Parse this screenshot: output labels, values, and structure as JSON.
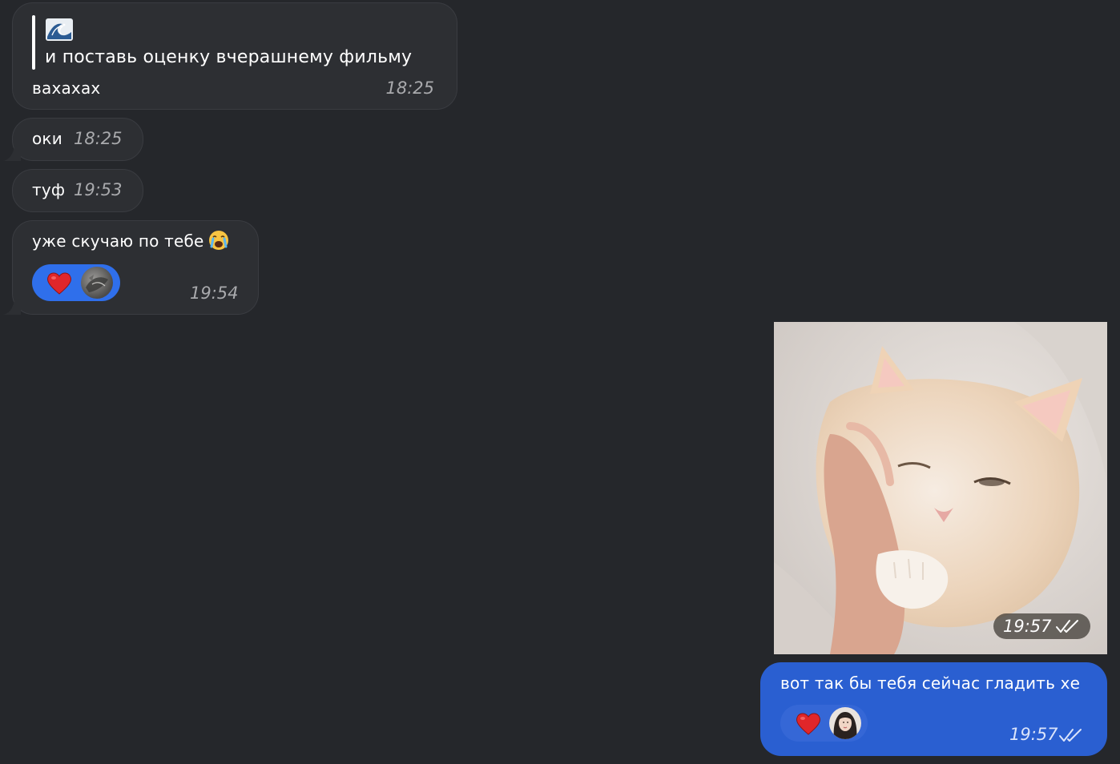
{
  "colors": {
    "background": "#25272b",
    "incoming_bubble": "#2d2f33",
    "outgoing_bubble": "#2a5fd1",
    "reaction_pill_incoming": "#2f6feb",
    "reaction_pill_outgoing": "#3567d6"
  },
  "messages": [
    {
      "quote": {
        "icon": "wave-emoji-icon",
        "text": "и поставь оценку вчерашнему фильму"
      },
      "text": "вахахах",
      "time": "18:25"
    },
    {
      "text": "оки",
      "time": "18:25"
    },
    {
      "text": "туф",
      "time": "19:53"
    },
    {
      "text": "уже скучаю по тебе",
      "emoji": "crying-face-emoji-icon",
      "time": "19:54",
      "reaction": {
        "emoji": "red-heart-icon",
        "user": "cat-avatar"
      }
    }
  ],
  "outgoing": {
    "photo": {
      "subject": "kitten-photo",
      "time": "19:57",
      "status": "double-check-icon"
    },
    "text": "вот так бы тебя сейчас гладить хе",
    "time": "19:57",
    "status": "double-check-icon",
    "reaction": {
      "emoji": "red-heart-icon",
      "user": "girl-avatar"
    }
  }
}
